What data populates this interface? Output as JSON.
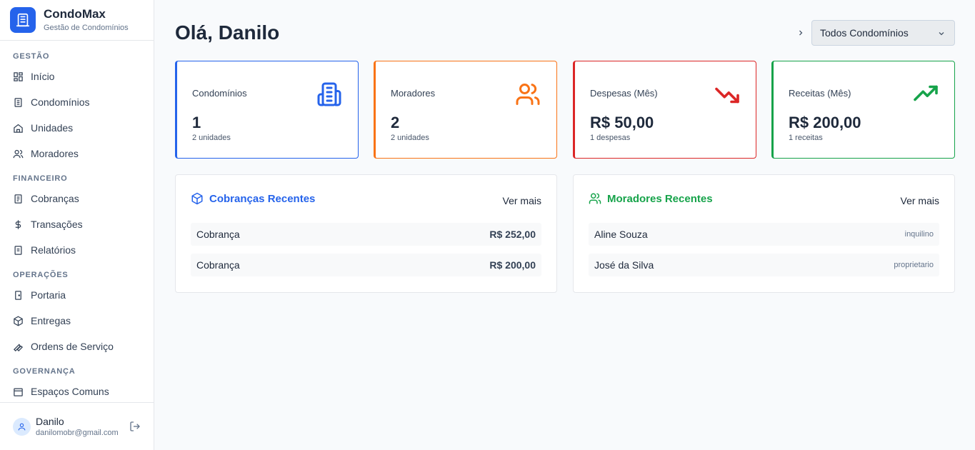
{
  "brand": {
    "name": "CondoMax",
    "subtitle": "Gestão de Condomínios"
  },
  "sidebar": {
    "sections": [
      {
        "title": "GESTÃO",
        "items": [
          {
            "label": "Início",
            "icon": "dashboard-icon"
          },
          {
            "label": "Condomínios",
            "icon": "building-icon"
          },
          {
            "label": "Unidades",
            "icon": "home-icon"
          },
          {
            "label": "Moradores",
            "icon": "users-icon"
          }
        ]
      },
      {
        "title": "FINANCEIRO",
        "items": [
          {
            "label": "Cobranças",
            "icon": "receipt-icon"
          },
          {
            "label": "Transações",
            "icon": "dollar-icon"
          },
          {
            "label": "Relatórios",
            "icon": "report-icon"
          }
        ]
      },
      {
        "title": "OPERAÇÕES",
        "items": [
          {
            "label": "Portaria",
            "icon": "door-icon"
          },
          {
            "label": "Entregas",
            "icon": "package-icon"
          },
          {
            "label": "Ordens de Serviço",
            "icon": "wrench-icon"
          }
        ]
      },
      {
        "title": "GOVERNANÇA",
        "items": [
          {
            "label": "Espaços Comuns",
            "icon": "calendar-icon"
          }
        ]
      }
    ]
  },
  "user": {
    "name": "Danilo",
    "email": "danilomobr@gmail.com"
  },
  "header": {
    "greeting": "Olá, Danilo",
    "selector_value": "Todos Condomínios"
  },
  "stats": [
    {
      "label": "Condomínios",
      "value": "1",
      "sub": "2 unidades",
      "color": "#2563eb",
      "icon": "building-icon"
    },
    {
      "label": "Moradores",
      "value": "2",
      "sub": "2 unidades",
      "color": "#f97316",
      "icon": "users-icon"
    },
    {
      "label": "Despesas (Mês)",
      "value": "R$ 50,00",
      "sub": "1 despesas",
      "color": "#dc2626",
      "icon": "trending-down-icon"
    },
    {
      "label": "Receitas (Mês)",
      "value": "R$ 200,00",
      "sub": "1 receitas",
      "color": "#16a34a",
      "icon": "trending-up-icon"
    }
  ],
  "charges_panel": {
    "title": "Cobranças Recentes",
    "link": "Ver mais",
    "color": "#2563eb",
    "rows": [
      {
        "label": "Cobrança",
        "amount": "R$ 252,00"
      },
      {
        "label": "Cobrança",
        "amount": "R$ 200,00"
      }
    ]
  },
  "residents_panel": {
    "title": "Moradores Recentes",
    "link": "Ver mais",
    "color": "#16a34a",
    "rows": [
      {
        "label": "Aline Souza",
        "tag": "inquilino"
      },
      {
        "label": "José da Silva",
        "tag": "proprietario"
      }
    ]
  }
}
